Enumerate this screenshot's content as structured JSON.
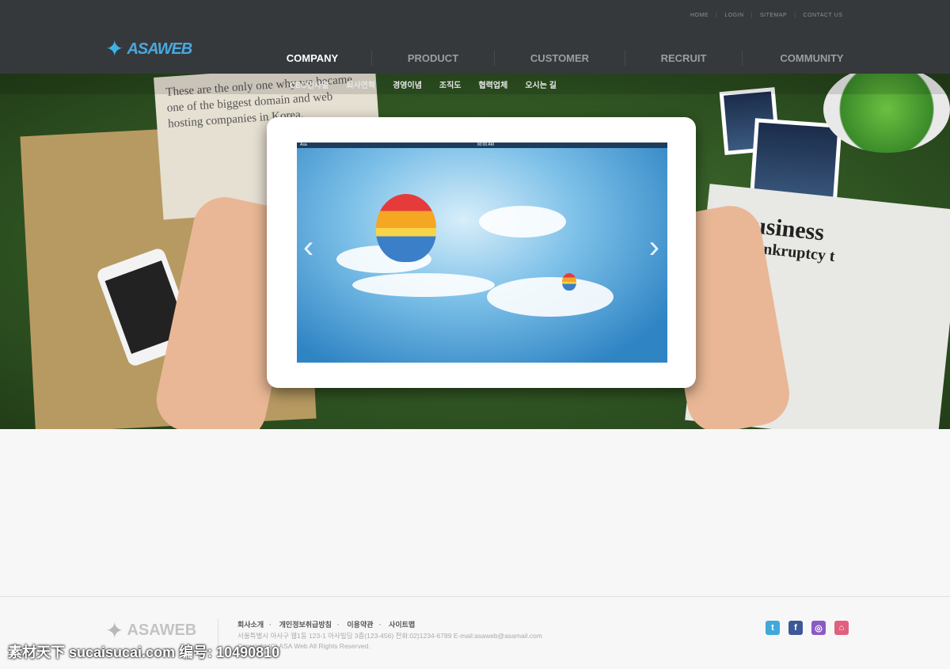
{
  "header": {
    "utility_links": [
      "HOME",
      "LOGIN",
      "SITEMAP",
      "CONTACT US"
    ],
    "logo": "ASAWEB",
    "nav": [
      {
        "label": "COMPANY",
        "active": true
      },
      {
        "label": "PRODUCT"
      },
      {
        "label": "CUSTOMER"
      },
      {
        "label": "RECRUIT"
      },
      {
        "label": "COMMUNITY"
      }
    ],
    "subnav": [
      "CEO인사말",
      "회사연혁",
      "경영이념",
      "조직도",
      "협력업체",
      "오시는 길"
    ]
  },
  "hero": {
    "paper_text": "These are the only one why we became one of the biggest domain and web hosting companies in Korea.",
    "news_headline": "Business",
    "news_sub": "a bankruptcy t",
    "tablet_status_left": "Asa",
    "tablet_status_center": "00:00 AM",
    "prev_icon": "chevron-left-icon",
    "next_icon": "chevron-right-icon"
  },
  "footer": {
    "logo": "ASAWEB",
    "links": [
      "회사소개",
      "개인정보취급방침",
      "이용약관",
      "사이트맵"
    ],
    "address": "서울특별시 아사구 웹1동 123-1 아사빌딩 3층(123-456) 전화:02)1234-6789 E-mail:asaweb@asamail.com",
    "copyright": "Copyright (C) ASA Web All Rights Reserved.",
    "social": [
      {
        "name": "twitter-icon",
        "glyph": "t",
        "color": "#3fa9d9"
      },
      {
        "name": "facebook-icon",
        "glyph": "f",
        "color": "#3b5998"
      },
      {
        "name": "instagram-icon",
        "glyph": "◎",
        "color": "#8a5bc4"
      },
      {
        "name": "blog-icon",
        "glyph": "⌂",
        "color": "#e0607e"
      }
    ]
  },
  "watermark": "素材天下 sucaisucai.com  编号: 10490810"
}
